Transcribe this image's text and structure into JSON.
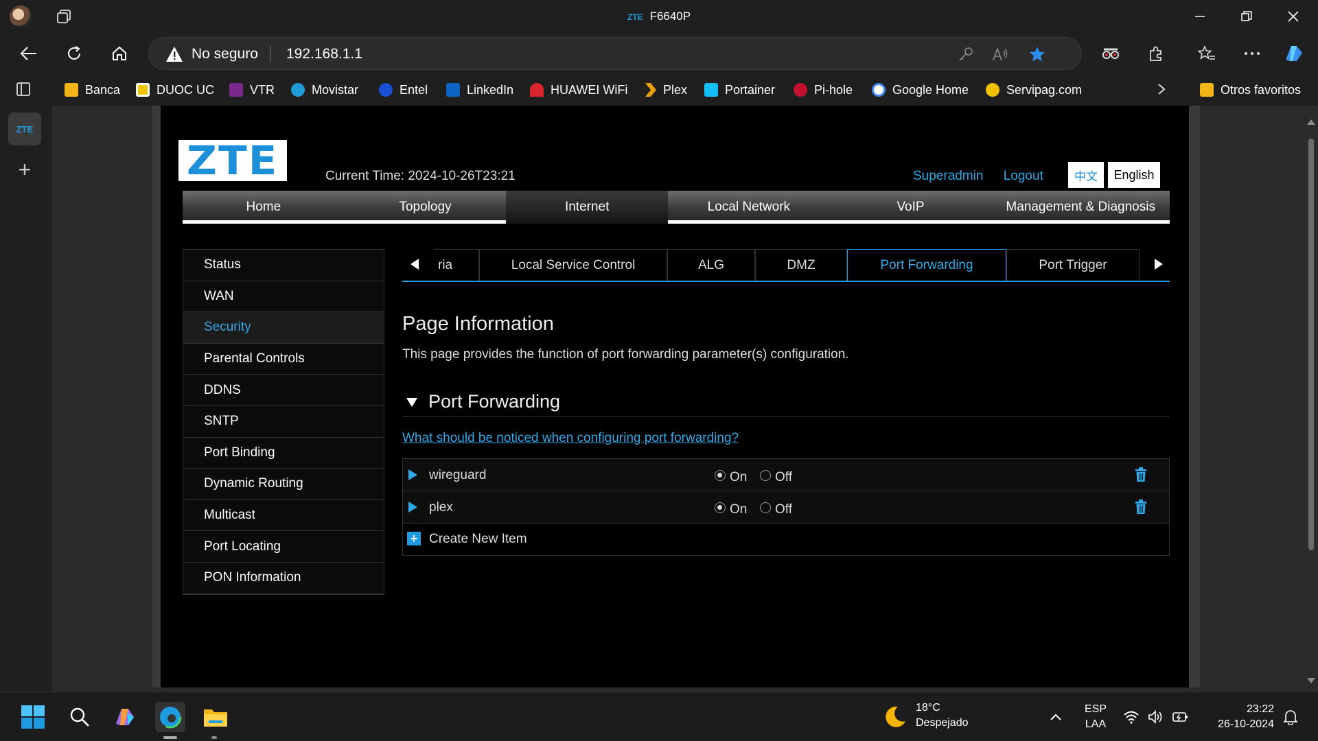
{
  "browser": {
    "window_title": "F6640P",
    "window_title_logo": "ZTE",
    "address": {
      "security_label": "No seguro",
      "url": "192.168.1.1"
    },
    "bookmarks": [
      {
        "label": "Banca",
        "color": "#f2b417"
      },
      {
        "label": "DUOC UC",
        "color": "#f2c500"
      },
      {
        "label": "VTR",
        "color": "#7a2a8c"
      },
      {
        "label": "Movistar",
        "color": "#1f9bd7"
      },
      {
        "label": "Entel",
        "color": "#1a4fd6"
      },
      {
        "label": "LinkedIn",
        "color": "#0a66c2"
      },
      {
        "label": "HUAWEI WiFi",
        "color": "#d8262c"
      },
      {
        "label": "Plex",
        "color": "#e5a00d"
      },
      {
        "label": "Portainer",
        "color": "#13bef9"
      },
      {
        "label": "Pi-hole",
        "color": "#c3102c"
      },
      {
        "label": "Google Home",
        "color": "#ffffff"
      },
      {
        "label": "Servipag.com",
        "color": "#f3c000"
      }
    ],
    "other_favorites": "Otros favoritos",
    "vertical_tab_label": "ZTE"
  },
  "router": {
    "logo": "ZTE",
    "current_time": "Current Time: 2024-10-26T23:21",
    "user_link": "Superadmin",
    "logout_link": "Logout",
    "lang_zh": "中文",
    "lang_en": "English",
    "main_nav": [
      "Home",
      "Topology",
      "Internet",
      "Local Network",
      "VoIP",
      "Management & Diagnosis"
    ],
    "active_main_nav": "Internet",
    "sidebar": [
      "Status",
      "WAN",
      "Security",
      "Parental Controls",
      "DDNS",
      "SNTP",
      "Port Binding",
      "Dynamic Routing",
      "Multicast",
      "Port Locating",
      "PON Information"
    ],
    "active_sidebar": "Security",
    "subtabs": [
      "ria",
      "Local Service Control",
      "ALG",
      "DMZ",
      "Port Forwarding",
      "Port Trigger"
    ],
    "active_subtab": "Port Forwarding",
    "page_info_title": "Page Information",
    "page_info_desc": "This page provides the function of port forwarding parameter(s) configuration.",
    "section_title": "Port Forwarding",
    "help_link": "What should be noticed when configuring port forwarding?",
    "rules": [
      {
        "name": "wireguard",
        "state": "On"
      },
      {
        "name": "plex",
        "state": "On"
      }
    ],
    "radio_on_label": "On",
    "radio_off_label": "Off",
    "create_new_item": "Create New Item"
  },
  "taskbar": {
    "weather_temp": "18°C",
    "weather_condition": "Despejado",
    "lang_line1": "ESP",
    "lang_line2": "LAA",
    "time": "23:22",
    "date": "26-10-2024"
  },
  "colors": {
    "accent": "#1e9be0",
    "link": "#2ea8e6",
    "page_bg": "#000000"
  }
}
